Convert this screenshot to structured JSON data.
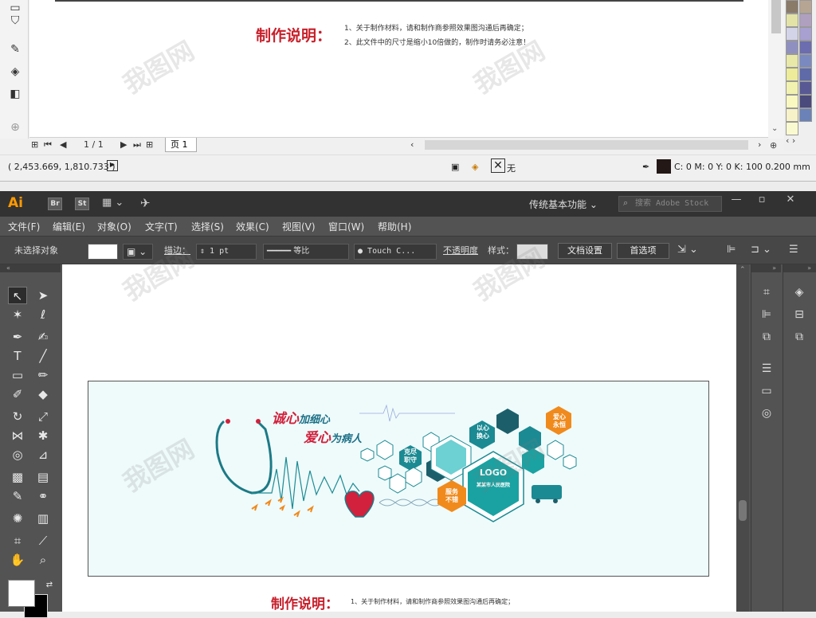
{
  "top_window": {
    "toolbox_icons": [
      "fill-bucket-icon",
      "eyedropper-icon",
      "paint-icon",
      "interactive-fill-icon",
      "add-icon"
    ],
    "instructions_title": "制作说明：",
    "instructions": [
      "1、关于制作材料，请和制作商参照效果图沟通后再确定；",
      "2、此文件中的尺寸是缩小10倍做的，制作时请务必注意！"
    ],
    "page_counter": "1 / 1",
    "page_tab": "页 1",
    "cursor_coords": "( 2,453.669, 1,810.733 )",
    "fill_none_label": "无",
    "color_readout": "C: 0 M: 0 Y: 0 K: 100  0.200 mm",
    "palette_colors": [
      "#8a7a68",
      "#b7a593",
      "#e3e3a8",
      "#b0a0c0",
      "#d4d4e8",
      "#a8a0d0",
      "#9090c0",
      "#6c6cb0",
      "#e8e8a8",
      "#7a8ac0",
      "#ecec9a",
      "#5f6aa8",
      "#f2f2b0",
      "#585894",
      "#f8f8c0",
      "#4a4a7c",
      "#f7f2c8",
      "#6a82b8",
      "#fafad0"
    ]
  },
  "ai": {
    "logo": "Ai",
    "chips": [
      "Br",
      "St"
    ],
    "workspace": "传统基本功能",
    "stock_placeholder": "搜索 Adobe Stock",
    "menu": [
      "文件(F)",
      "编辑(E)",
      "对象(O)",
      "文字(T)",
      "选择(S)",
      "效果(C)",
      "视图(V)",
      "窗口(W)",
      "帮助(H)"
    ],
    "control": {
      "no_selection": "未选择对象",
      "stroke_label": "描边：",
      "stroke_value": "1 pt",
      "stroke_profile": "等比",
      "brush": "Touch C...",
      "opacity": "不透明度",
      "style": "样式：",
      "doc_setup": "文档设置",
      "preferences": "首选项"
    },
    "artwork": {
      "slogan_red1": "诚心",
      "slogan_rest1": "加细心",
      "slogan_red2": "爱心",
      "slogan_rest2": "为病人",
      "hex_labels": {
        "yixin": "以心\n换心",
        "aixin": "爱心\n永恒",
        "jinzhi": "克尽\n职守",
        "logo": "LOGO",
        "hospital": "某某市人民医院",
        "fuwu": "服务\n不错"
      }
    },
    "instructions_title": "制作说明：",
    "instructions": [
      "1、关于制作材料，请和制作商参照效果图沟通后再确定；"
    ]
  }
}
